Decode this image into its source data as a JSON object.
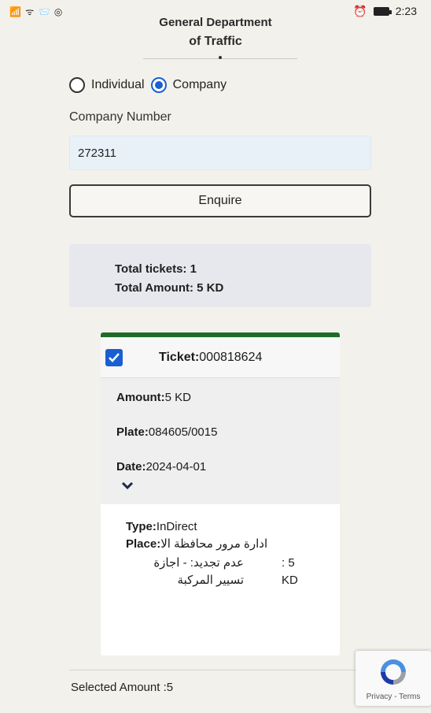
{
  "status_bar": {
    "left_icons": "📶 ᯤ 📨 ◎",
    "time": "2:23"
  },
  "header": {
    "title_line1": "General Department",
    "title_line2": "of Traffic"
  },
  "search_type": {
    "option_individual": "Individual",
    "option_company": "Company",
    "selected": "Company"
  },
  "form": {
    "label": "Company Number",
    "value": "272311",
    "button_label": "Enquire"
  },
  "summary": {
    "total_tickets": "Total tickets: 1",
    "total_amount": "Total Amount: 5 KD"
  },
  "ticket": {
    "checked": true,
    "number_label": "Ticket:",
    "number_value": "000818624",
    "amount_label": "Amount:",
    "amount_value": "5 KD",
    "plate_label": "Plate:",
    "plate_value": "084605/0015",
    "date_label": "Date:",
    "date_value": "2024-04-01",
    "type_label": "Type:",
    "type_value": "InDirect",
    "place_label": "Place:",
    "place_value": "ادارة مرور محافظة الا",
    "fee_description": "عدم تجديد: - اجازة تسيير المركبة",
    "fee_amount": ": 5 KD"
  },
  "footer": {
    "selected_amount": "Selected Amount :5"
  },
  "recaptcha": {
    "links": "Privacy - Terms"
  },
  "colors": {
    "accent_blue": "#1a5fd1",
    "ticket_border_green": "#1f6b2a"
  }
}
